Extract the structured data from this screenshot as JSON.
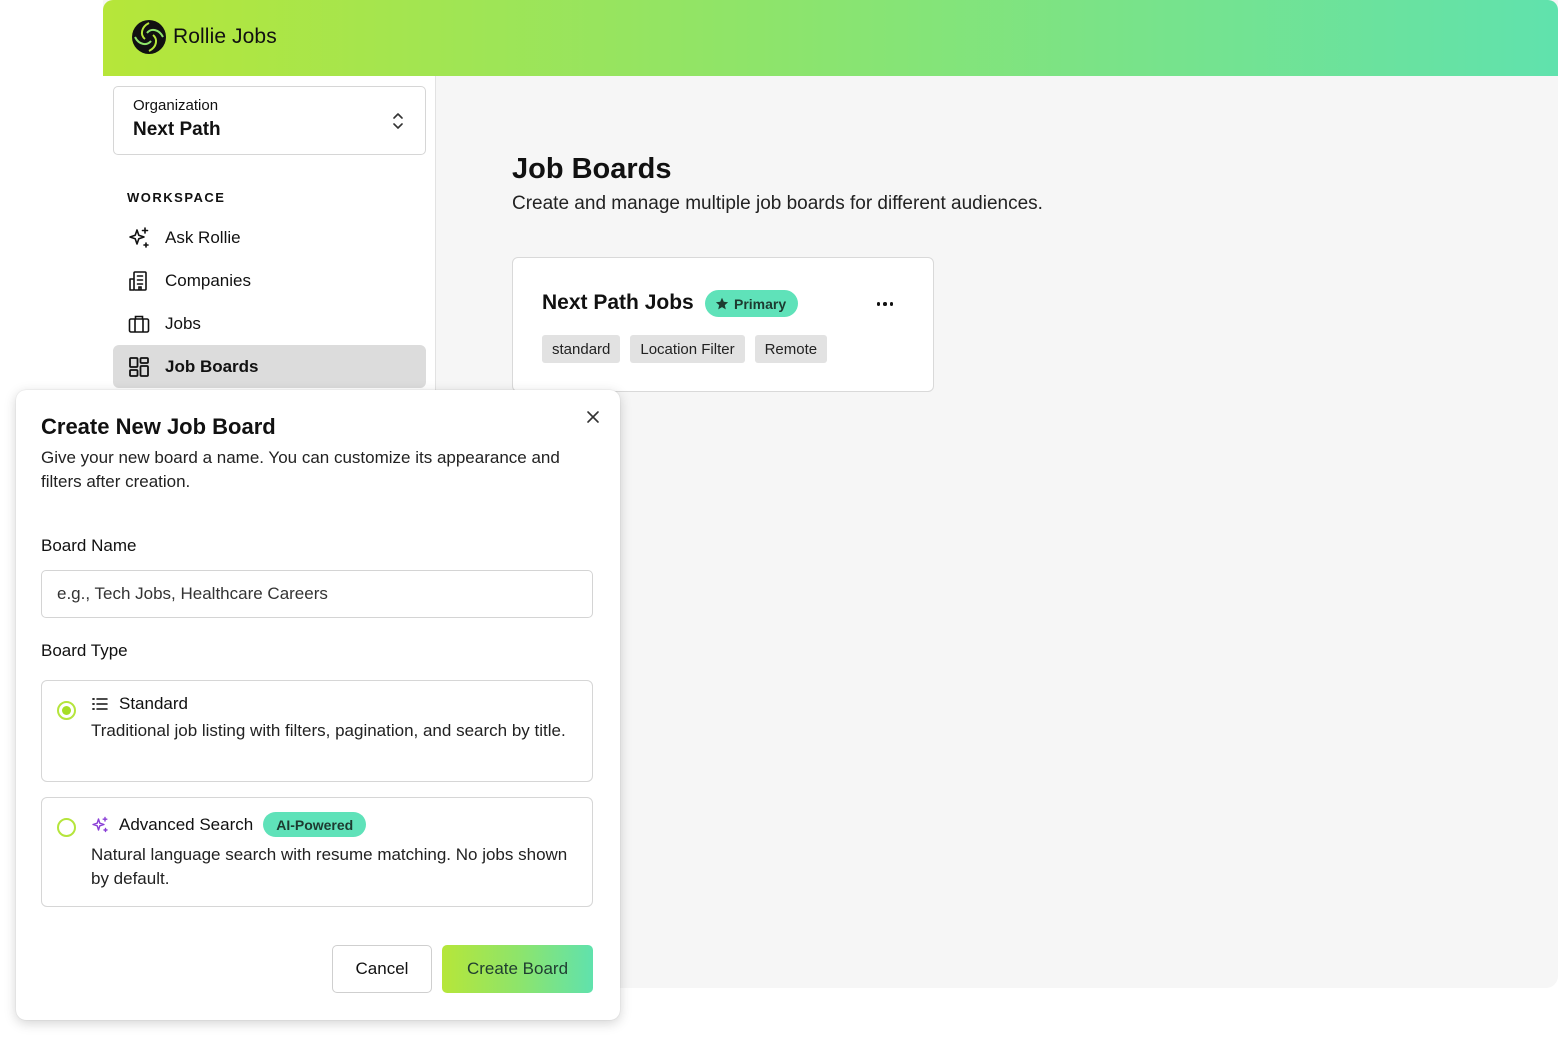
{
  "app": {
    "name": "Rollie Jobs",
    "logo_icon": "rollie-spiral-logo",
    "brand_gradient": [
      "#b6e639",
      "#60e2ad"
    ]
  },
  "sidebar": {
    "org_label": "Organization",
    "org_value": "Next Path",
    "section_label": "WORKSPACE",
    "items": [
      {
        "label": "Ask Rollie",
        "icon": "sparkle-icon",
        "active": false
      },
      {
        "label": "Companies",
        "icon": "building-icon",
        "active": false
      },
      {
        "label": "Jobs",
        "icon": "briefcase-icon",
        "active": false
      },
      {
        "label": "Job Boards",
        "icon": "grid-icon",
        "active": true
      }
    ]
  },
  "main": {
    "title": "Job Boards",
    "subtitle": "Create and manage multiple job boards for different audiences.",
    "boards": [
      {
        "name": "Next Path Jobs",
        "badge": "Primary",
        "tags": [
          "standard",
          "Location Filter",
          "Remote"
        ]
      }
    ]
  },
  "modal": {
    "title": "Create New Job Board",
    "description": "Give your new board a name. You can customize its appearance and filters after creation.",
    "board_name_label": "Board Name",
    "board_name_value": "",
    "board_name_placeholder": "e.g., Tech Jobs, Healthcare Careers",
    "board_type_label": "Board Type",
    "options": [
      {
        "title": "Standard",
        "icon": "list-icon",
        "description": "Traditional job listing with filters, pagination, and search by title.",
        "selected": true
      },
      {
        "title": "Advanced Search",
        "icon": "sparkle-icon",
        "badge": "AI-Powered",
        "description": "Natural language search with resume matching. No jobs shown by default.",
        "selected": false
      }
    ],
    "cancel_label": "Cancel",
    "create_label": "Create Board"
  }
}
